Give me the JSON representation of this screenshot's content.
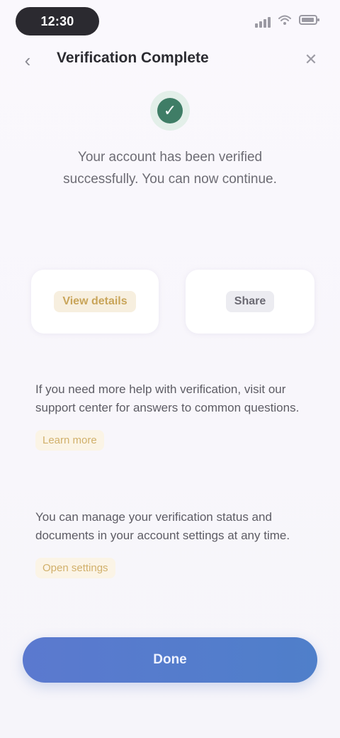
{
  "status_bar": {
    "time": "12:30"
  },
  "header": {
    "title": "Verification Complete",
    "back_icon": "chevron-left-icon",
    "close_icon": "close-icon"
  },
  "success": {
    "icon": "checkmark-icon",
    "message": "Your account has been verified successfully. You can now continue."
  },
  "options": [
    {
      "label": "View details"
    },
    {
      "label": "Share"
    }
  ],
  "faq": [
    {
      "question": "If you need more help with verification, visit our support center for answers to common questions.",
      "link": "Learn more"
    },
    {
      "question": "You can manage your verification status and documents in your account settings at any time.",
      "link": "Open settings"
    }
  ],
  "cta": {
    "label": "Done"
  },
  "colors": {
    "accent": "#5B79CF",
    "success": "#3F7D66",
    "link": "#D1B06B",
    "background": "#F7F5FB"
  }
}
